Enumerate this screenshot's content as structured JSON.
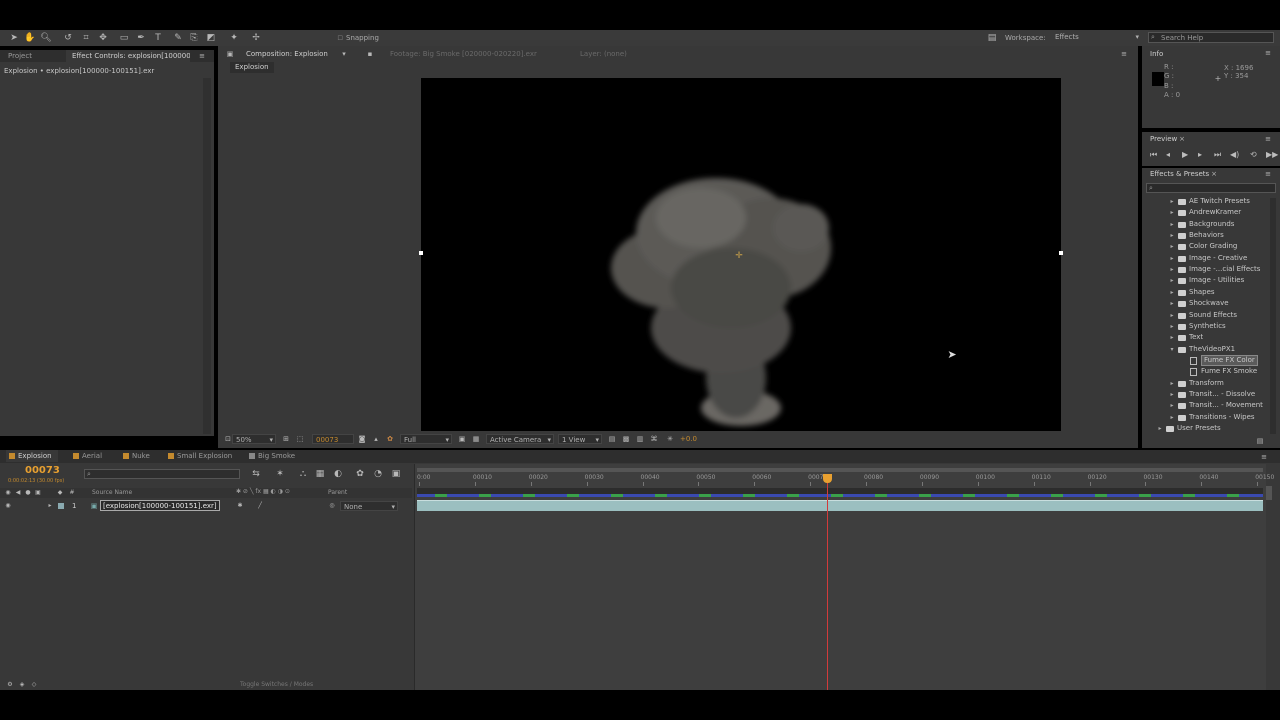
{
  "toolbar": {
    "snapping_label": "Snapping",
    "workspace_label": "Workspace:",
    "workspace_value": "Effects",
    "search_placeholder": "Search Help"
  },
  "left_panel": {
    "tabs": [
      "Project",
      "Effect Controls: explosion[100000"
    ],
    "subtitle": "Explosion • explosion[100000-100151].exr"
  },
  "viewer": {
    "tabs": [
      "Composition: Explosion",
      "Footage: Big Smoke [020000-020220].exr",
      "Layer: (none)"
    ],
    "breadcrumb": "Explosion",
    "bottom": {
      "zoom": "50%",
      "timecode": "00073",
      "resolution": "Full",
      "camera": "Active Camera",
      "view": "1 View",
      "exposure": "+0.0"
    }
  },
  "info_panel": {
    "title": "Info",
    "r": "R :",
    "g": "G :",
    "b": "B :",
    "a": "A : 0",
    "x": "X : 1696",
    "y": "Y : 354"
  },
  "preview_panel": {
    "title": "Preview"
  },
  "effects_panel": {
    "title": "Effects & Presets",
    "items": [
      {
        "label": "AE Twitch Presets",
        "type": "folder",
        "level": 1,
        "expanded": false
      },
      {
        "label": "AndrewKramer",
        "type": "folder",
        "level": 1,
        "expanded": false
      },
      {
        "label": "Backgrounds",
        "type": "folder",
        "level": 1,
        "expanded": false
      },
      {
        "label": "Behaviors",
        "type": "folder",
        "level": 1,
        "expanded": false
      },
      {
        "label": "Color Grading",
        "type": "folder",
        "level": 1,
        "expanded": false
      },
      {
        "label": "Image - Creative",
        "type": "folder",
        "level": 1,
        "expanded": false
      },
      {
        "label": "Image -...cial Effects",
        "type": "folder",
        "level": 1,
        "expanded": false
      },
      {
        "label": "Image - Utilities",
        "type": "folder",
        "level": 1,
        "expanded": false
      },
      {
        "label": "Shapes",
        "type": "folder",
        "level": 1,
        "expanded": false
      },
      {
        "label": "Shockwave",
        "type": "folder",
        "level": 1,
        "expanded": false
      },
      {
        "label": "Sound Effects",
        "type": "folder",
        "level": 1,
        "expanded": false
      },
      {
        "label": "Synthetics",
        "type": "folder",
        "level": 1,
        "expanded": false
      },
      {
        "label": "Text",
        "type": "folder",
        "level": 1,
        "expanded": false
      },
      {
        "label": "TheVideoPX1",
        "type": "folder",
        "level": 1,
        "expanded": true
      },
      {
        "label": "Fume FX Color",
        "type": "preset",
        "level": 2,
        "expanded": false
      },
      {
        "label": "Fume FX Smoke",
        "type": "preset",
        "level": 2,
        "expanded": false
      },
      {
        "label": "Transform",
        "type": "folder",
        "level": 1,
        "expanded": false
      },
      {
        "label": "Transit... - Dissolve",
        "type": "folder",
        "level": 1,
        "expanded": false
      },
      {
        "label": "Transit... - Movement",
        "type": "folder",
        "level": 1,
        "expanded": false
      },
      {
        "label": "Transitions - Wipes",
        "type": "folder",
        "level": 1,
        "expanded": false
      },
      {
        "label": "User Presets",
        "type": "folder",
        "level": 0,
        "expanded": false
      }
    ]
  },
  "timeline": {
    "tabs": [
      "Explosion",
      "Aerial",
      "Nuke",
      "Small Explosion",
      "Big Smoke"
    ],
    "timecode": "00073",
    "timecode_sub": "0:00:02:13 (30.00 fps)",
    "search_placeholder": "",
    "col_source": "Source Name",
    "col_parent": "Parent",
    "layer": {
      "number": "1",
      "name": "[explosion[100000-100151].exr]",
      "parent": "None"
    },
    "ruler": [
      "0:00",
      "00010",
      "00020",
      "00030",
      "00040",
      "00050",
      "00060",
      "00070",
      "00080",
      "00090",
      "00100",
      "00110",
      "00120",
      "00130",
      "00140",
      "00150"
    ],
    "playhead_frame": 73,
    "total_frames": 152,
    "footer_toggle": "Toggle Switches / Modes"
  },
  "colors": {
    "panel_bg": "#383838",
    "viewer_bg": "#000000",
    "layer_bar": "#9bbfc0",
    "playhead": "#d23b3b",
    "timecode_accent": "#e8a030"
  }
}
